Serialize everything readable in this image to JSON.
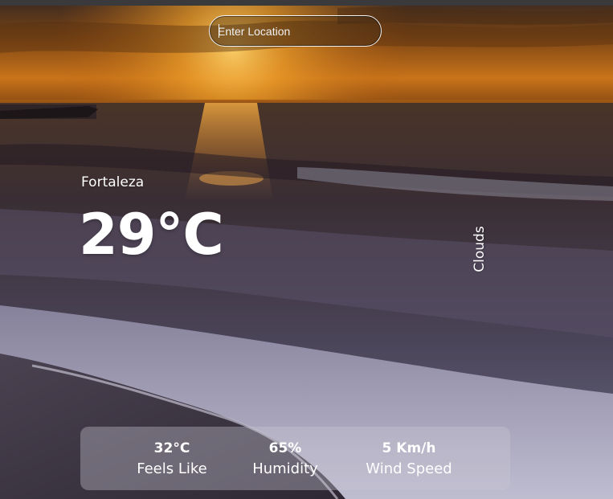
{
  "search": {
    "placeholder": "Enter Location"
  },
  "weather": {
    "location": "Fortaleza",
    "temperature": "29°C",
    "condition": "Clouds"
  },
  "details": {
    "feels_like": {
      "value": "32°C",
      "label": "Feels Like"
    },
    "humidity": {
      "value": "65%",
      "label": "Humidity"
    },
    "wind_speed": {
      "value": "5 Km/h",
      "label": "Wind Speed"
    }
  },
  "background": {
    "description_icon": "sunset-beach-image",
    "colors": {
      "sky_top": "#4a2a10",
      "sky_glow": "#e8961c",
      "horizon": "#a85a14",
      "sea_dark": "#2c2430",
      "surf": "#8a8aa6",
      "sand": "#3c3642"
    }
  }
}
